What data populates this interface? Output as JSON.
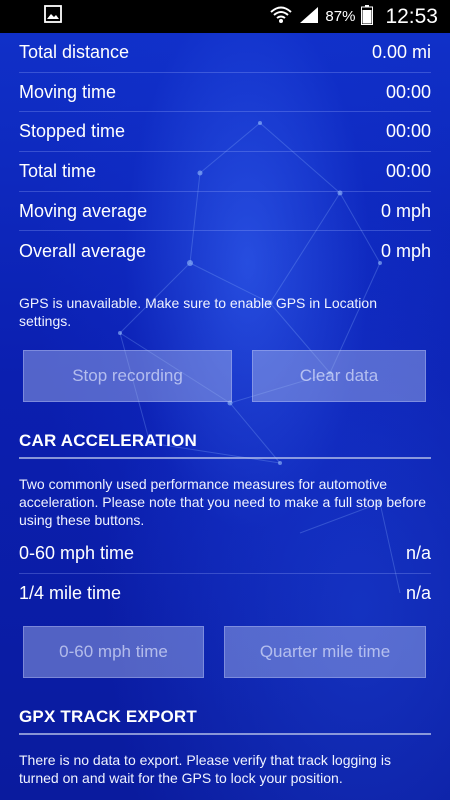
{
  "status_bar": {
    "notification_icon": "image-icon",
    "wifi_icon": "wifi-icon",
    "signal_icon": "signal-icon",
    "battery_percent": "87%",
    "battery_icon": "battery-icon",
    "time": "12:53"
  },
  "stats": [
    {
      "label": "Total distance",
      "value": "0.00 mi"
    },
    {
      "label": "Moving time",
      "value": "00:00"
    },
    {
      "label": "Stopped time",
      "value": "00:00"
    },
    {
      "label": "Total time",
      "value": "00:00"
    },
    {
      "label": "Moving average",
      "value": "0 mph"
    },
    {
      "label": "Overall average",
      "value": "0 mph"
    }
  ],
  "gps_notice": "GPS is unavailable. Make sure to enable GPS in Location settings.",
  "buttons": {
    "stop_recording": "Stop recording",
    "clear_data": "Clear data",
    "zero_sixty": "0-60 mph time",
    "quarter_mile": "Quarter mile time"
  },
  "car_acceleration": {
    "title": "CAR ACCELERATION",
    "description": "Two commonly used performance measures for automotive acceleration. Please note that you need to make a full stop before using these buttons.",
    "rows": [
      {
        "label": "0-60 mph time",
        "value": "n/a"
      },
      {
        "label": "1/4 mile time",
        "value": "n/a"
      }
    ]
  },
  "gpx_export": {
    "title": "GPX TRACK EXPORT",
    "description": "There is no data to export. Please verify that track logging is turned on and wait for the GPS to lock your position."
  },
  "colors": {
    "background": "#0b1fb0",
    "status_bar": "#000000",
    "button_disabled": "#8f9ad6"
  }
}
